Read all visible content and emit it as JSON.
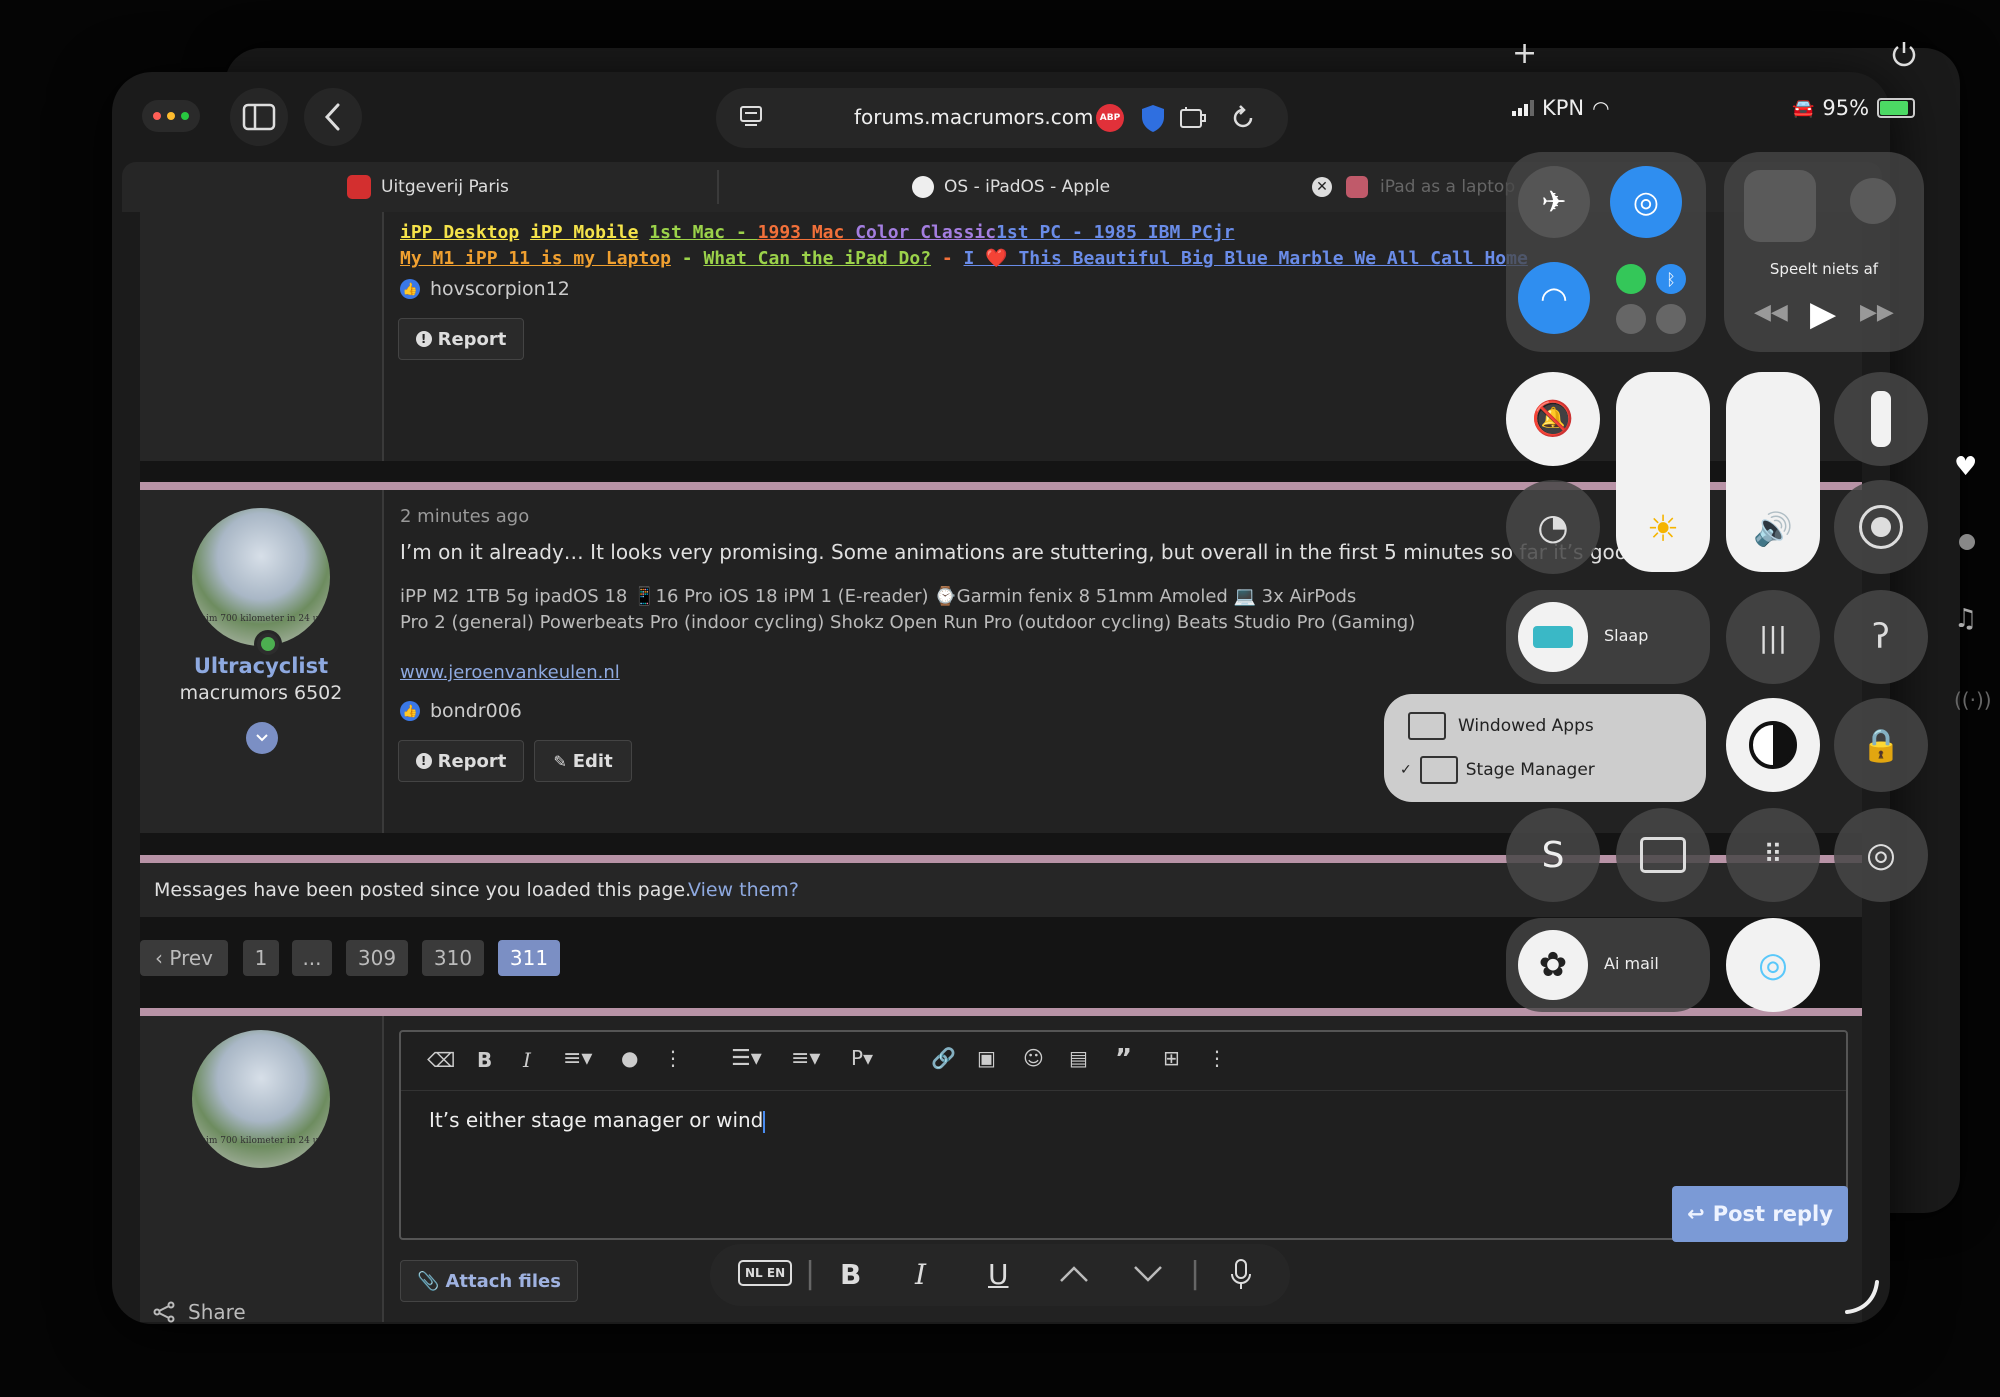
{
  "status": {
    "carrier": "KPN",
    "battery": "95%"
  },
  "browser": {
    "url": "forums.macrumors.com",
    "adblock_badge": "ABP",
    "tabs": [
      {
        "label": "Uitgeverij Paris"
      },
      {
        "label": "OS - iPadOS - Apple"
      },
      {
        "label": "iPad as a laptop"
      }
    ]
  },
  "post1": {
    "signature_line1": [
      {
        "text": "iPP Desktop",
        "color": "#f5e34a"
      },
      {
        "text": "iPP Mobile",
        "color": "#f5e34a"
      },
      {
        "text": "1st Mac - ",
        "color": "#9bd24a"
      },
      {
        "text": "1993 Mac ",
        "color": "#f2703a"
      },
      {
        "text": "Color Classic",
        "color": "#a47ee0"
      },
      {
        "text": "1st PC - 1985 IBM PCjr",
        "color": "#6a8ce8"
      }
    ],
    "signature_line2": [
      {
        "text": "My M1 iPP 11 is my Laptop",
        "color": "#f0a030"
      },
      {
        "text": " - ",
        "color": "#9bd24a"
      },
      {
        "text": "What Can the iPad Do?",
        "color": "#9bd24a"
      },
      {
        "text": " - ",
        "color": "#f2703a"
      },
      {
        "text": "I ❤️ This Beautiful Big Blue Marble We All Call Home",
        "color": "#6a8ce8"
      }
    ],
    "reaction_user": "hovscorpion12",
    "report_label": "Report"
  },
  "post2": {
    "username": "Ultracyclist",
    "user_title": "macrumors 6502",
    "avatar_caption": "Ruim 700 kilometer in 24 uur",
    "timestamp": "2 minutes ago",
    "body": "I’m on it already… It looks very promising. Some animations are stuttering, but overall in the first 5 minutes so far it’s good",
    "sig_line1": "iPP M2 1TB 5g ipadOS 18 📱16 Pro iOS 18 iPM 1 (E-reader) ⌚Garmin fenix 8 51mm Amoled 💻 3x AirPods",
    "sig_line2": "Pro 2 (general) Powerbeats Pro (indoor cycling) Shokz Open Run Pro (outdoor cycling) Beats Studio Pro (Gaming)",
    "website": "www.jeroenvankeulen.nl",
    "reaction_user": "bondr006",
    "report_label": "Report",
    "edit_label": "Edit"
  },
  "notice": {
    "text": "Messages have been posted since you loaded this page.",
    "link": "View them?"
  },
  "pagination": {
    "prev": "‹ Prev",
    "pages": [
      "1",
      "...",
      "309",
      "310",
      "311"
    ],
    "current": "311"
  },
  "reply": {
    "avatar_caption": "Ruim 700 kilometer in 24 uur",
    "text": "It’s either stage manager or wind",
    "attach_label": "Attach files",
    "post_label": "Post reply"
  },
  "control_center": {
    "now_playing": "Speelt niets af",
    "focus_label": "Slaap",
    "menu": {
      "windowed": "Windowed Apps",
      "stage": "Stage Manager"
    },
    "ai_label": "Ai mail",
    "accent": "#2f8ef0"
  },
  "share_label": "Share",
  "keyboard_bar": {
    "lang": "NL EN",
    "bold": "B",
    "italic": "I",
    "underline": "U"
  }
}
